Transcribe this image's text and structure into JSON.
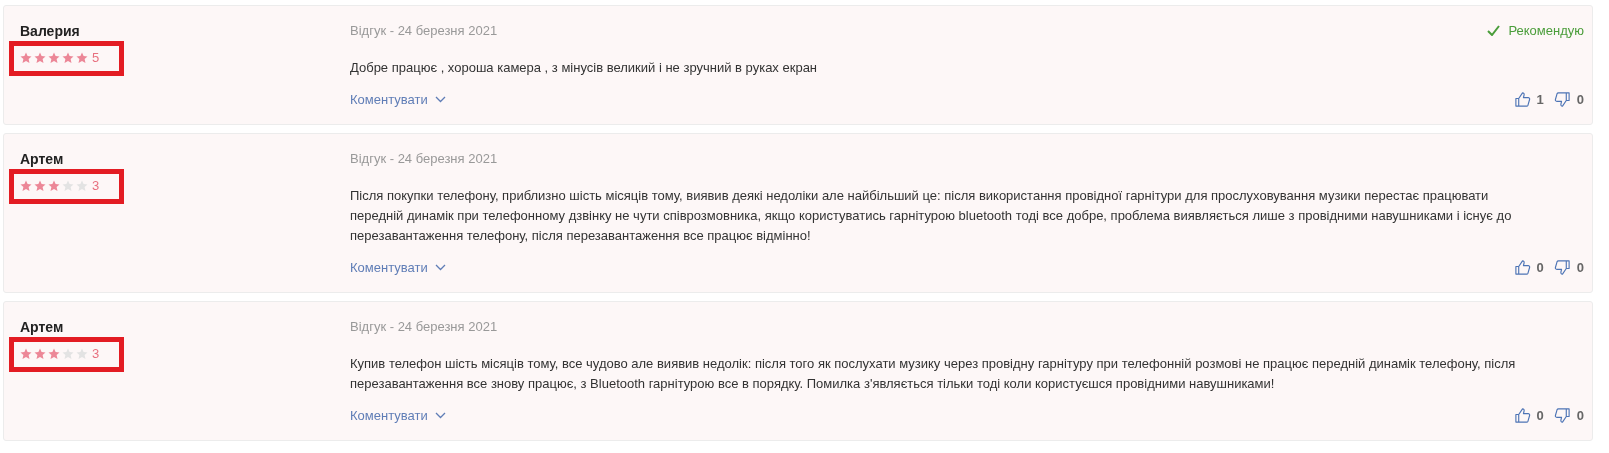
{
  "reviews": [
    {
      "author": "Валерия",
      "stars": 5,
      "rating": "5",
      "highlighted": true,
      "date": "Відгук - 24 березня 2021",
      "recommend": "Рекомендую",
      "text": "Добре працює , хороша камера , з мінусів великий і не зручний в руках екран",
      "comment": "Коментувати",
      "likes": "1",
      "dislikes": "0"
    },
    {
      "author": "Артем",
      "stars": 3,
      "rating": "3",
      "highlighted": true,
      "date": "Відгук - 24 березня 2021",
      "text": "Після покупки телефону, приблизно шість місяців тому, виявив деякі недоліки але найбільший це: після використання провідної гарнітури для прослуховування музики перестає працювати передній динамік при телефонному дзвінку не чути співрозмовника, якщо користуватись гарнітурою bluetooth тоді все добре, проблема виявляється лише з провідними навушниками і існує до перезавантаження телефону, після перезавантаження все працює відмінно!",
      "comment": "Коментувати",
      "likes": "0",
      "dislikes": "0"
    },
    {
      "author": "Артем",
      "stars": 3,
      "rating": "3",
      "highlighted": true,
      "date": "Відгук - 24 березня 2021",
      "text": "Купив телефон шість місяців тому, все чудово але виявив недолік: після того як послухати музику через провідну гарнітуру при телефонній розмові не працює передній динамік телефону, після перезавантаження все знову працює, з Bluetooth гарнітурою все в порядку. Помилка з'являється тільки тоді коли користуєшся провідними навушниками!",
      "comment": "Коментувати",
      "likes": "0",
      "dislikes": "0"
    }
  ]
}
